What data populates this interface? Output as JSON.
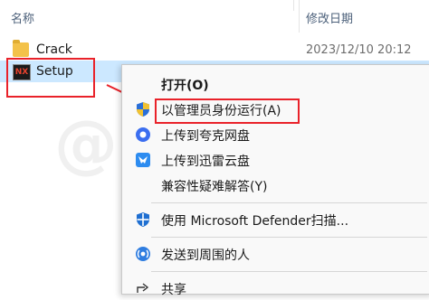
{
  "header": {
    "name_col": "名称",
    "date_col": "修改日期"
  },
  "files": [
    {
      "name": "Crack",
      "date": "2023/12/10 20:12",
      "icon": "folder-icon"
    },
    {
      "name": "Setup",
      "icon": "nx-app-icon",
      "icon_text": "NX"
    }
  ],
  "context_menu": {
    "items": [
      {
        "label": "打开(O)",
        "icon": ""
      },
      {
        "label": "以管理员身份运行(A)",
        "icon": "uac-shield-icon"
      },
      {
        "label": "上传到夸克网盘",
        "icon": "quark-icon"
      },
      {
        "label": "上传到迅雷云盘",
        "icon": "xunlei-icon"
      },
      {
        "label": "兼容性疑难解答(Y)",
        "icon": ""
      },
      {
        "label": "使用 Microsoft Defender扫描...",
        "icon": "defender-shield-icon"
      },
      {
        "label": "发送到周围的人",
        "icon": "nearby-share-icon"
      },
      {
        "label": "共享",
        "icon": "share-icon"
      }
    ]
  },
  "watermark": "@"
}
